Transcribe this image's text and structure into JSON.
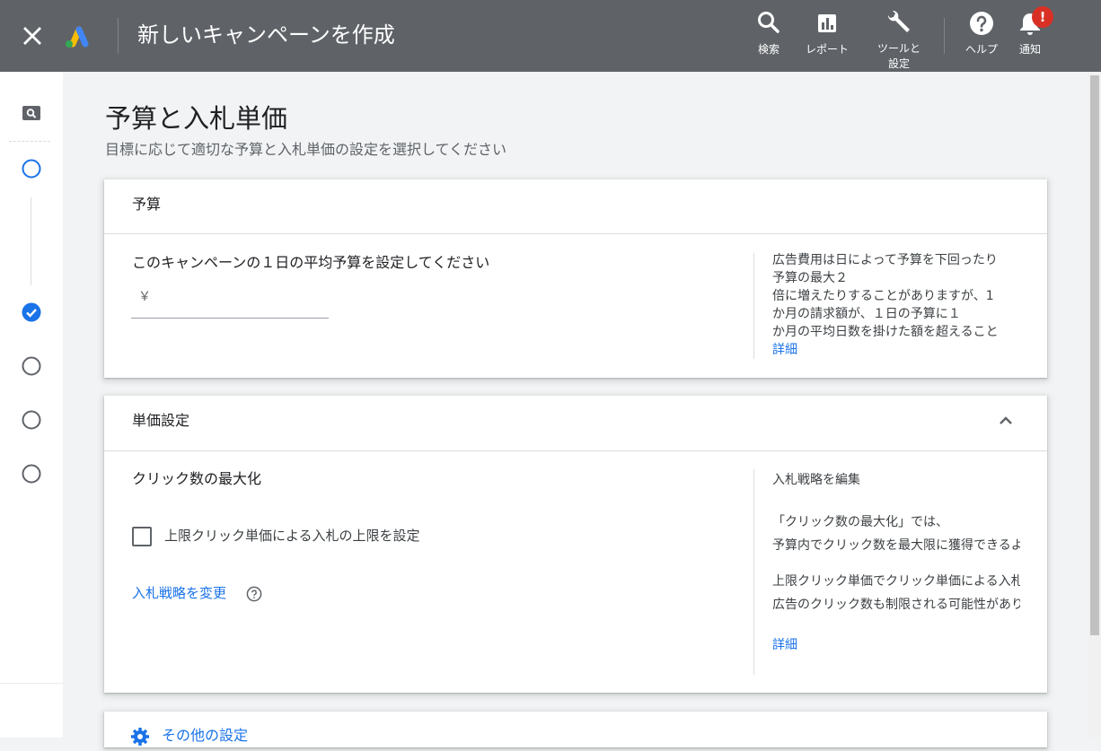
{
  "topbar": {
    "title": "新しいキャンペーンを作成",
    "items": [
      {
        "label": "検索",
        "icon": "search-icon"
      },
      {
        "label": "レポート",
        "icon": "reports-icon"
      },
      {
        "label": "ツールと\n設定",
        "icon": "wrench-icon"
      },
      {
        "label": "ヘルプ",
        "icon": "help-icon"
      },
      {
        "label": "通知",
        "icon": "bell-icon"
      }
    ],
    "notification_badge": "!"
  },
  "page": {
    "title": "予算と入札単価",
    "subtitle": "目標に応じて適切な予算と入札単価の設定を選択してください"
  },
  "budget": {
    "header": "予算",
    "label": "このキャンペーンの１日の平均予算を設定してください",
    "currency": "￥",
    "value": "",
    "info_lines": [
      "広告費用は日によって予算を下回ったり",
      "予算の最大２",
      "倍に増えたりすることがありますが、1",
      "か月の請求額が、１日の予算に１",
      "か月の平均日数を掛けた額を超えること"
    ],
    "info_link": "詳細"
  },
  "bidding": {
    "header": "単価設定",
    "strategy": "クリック数の最大化",
    "checkbox_label": "上限クリック単価による入札の上限を設定",
    "checkbox_checked": false,
    "change_link": "入札戦略を変更",
    "side_title": "入札戦略を編集",
    "side_para1_lines": [
      "「クリック数の最大化」では、",
      "予算内でクリック数を最大限に獲得できるように"
    ],
    "side_para2_lines": [
      "上限クリック単価でクリック単価による入札の上限を設定すると",
      "広告のクリック数も制限される可能性があります"
    ],
    "side_link": "詳細"
  },
  "other_settings": {
    "label": "その他の設定"
  },
  "colors": {
    "topbar_bg": "#5f6368",
    "link": "#1a73e8",
    "badge": "#d93025",
    "step_active": "#1a73e8"
  }
}
